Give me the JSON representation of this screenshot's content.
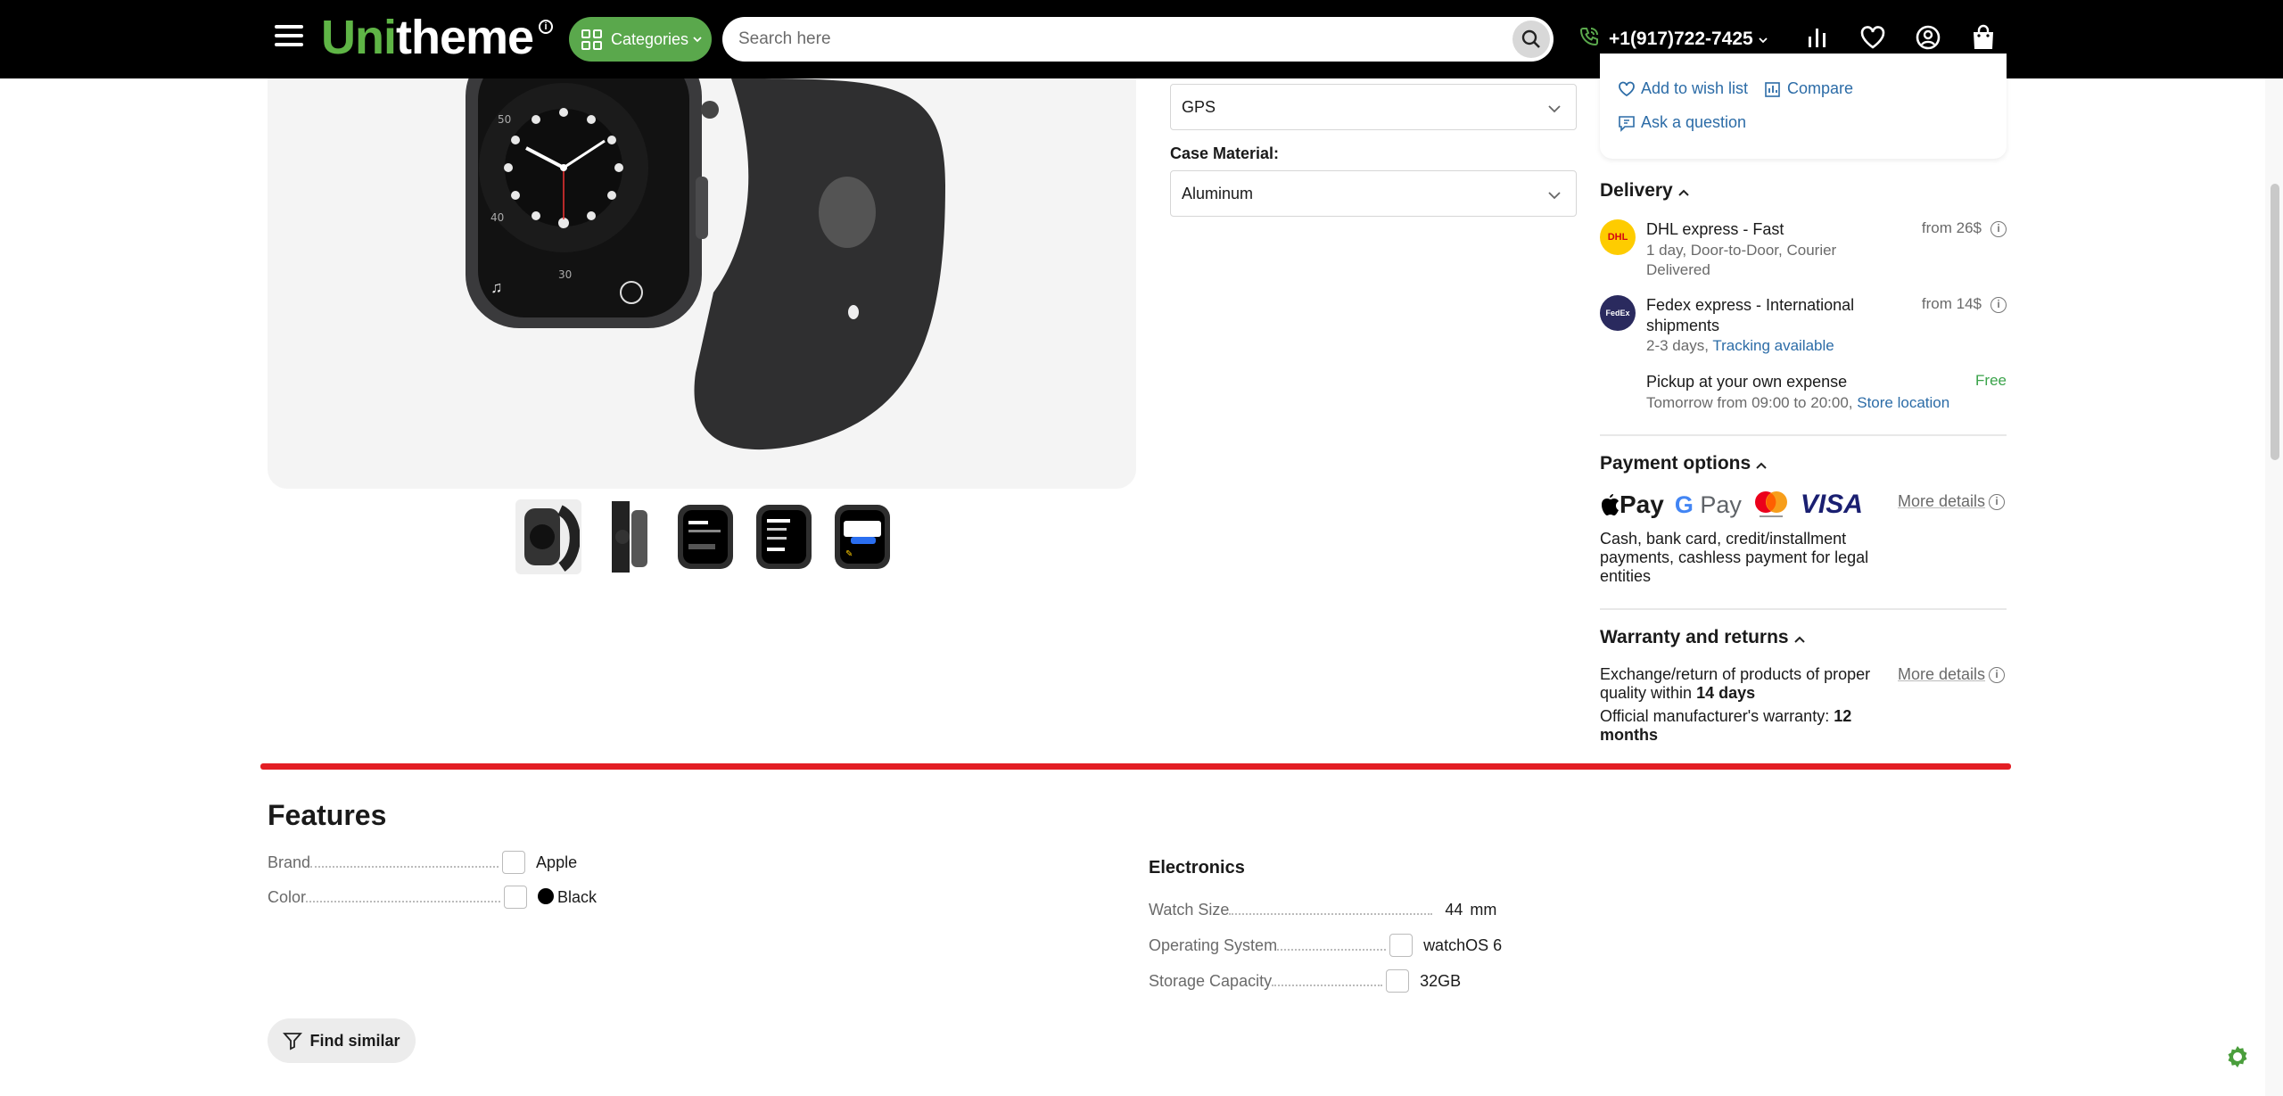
{
  "header": {
    "logo_part1": "Uni",
    "logo_part2": "theme",
    "categories_label": "Categories",
    "search_placeholder": "Search here",
    "phone": "+1(917)722-7425",
    "icons": [
      "menu-icon",
      "compare-chart-icon",
      "heart-icon",
      "user-icon",
      "bag-icon"
    ],
    "colors": {
      "background": "#000000",
      "accent": "#5aa84c"
    }
  },
  "gallery": {
    "thumbnail_count": 5,
    "active_thumbnail": 1
  },
  "options": {
    "connectivity_value": "GPS",
    "case_material_label": "Case Material:",
    "case_material_value": "Aluminum"
  },
  "actions": {
    "wish_list": "Add to wish list",
    "compare": "Compare",
    "ask_question": "Ask a question"
  },
  "delivery": {
    "title": "Delivery",
    "methods": [
      {
        "name": "DHL express - Fast",
        "sub": "1 day, Door-to-Door, Courier Delivered",
        "price": "from 26$",
        "logo": "DHL"
      },
      {
        "name": "Fedex express - International shipments",
        "sub": "2-3 days,",
        "sub_link": "Tracking available",
        "price": "from 14$",
        "logo": "FedEx"
      },
      {
        "name": "Pickup at your own expense",
        "sub": "Tomorrow from 09:00 to 20:00,",
        "sub_link": "Store location",
        "price": "Free"
      }
    ]
  },
  "payment": {
    "title": "Payment options",
    "logos": [
      "Apple Pay",
      "G Pay",
      "Mastercard",
      "VISA"
    ],
    "logo_text": {
      "apple": "Pay",
      "google": "Pay",
      "visa": "VISA"
    },
    "more": "More details",
    "text": "Cash, bank card, credit/installment payments, cashless payment for legal entities"
  },
  "warranty": {
    "title": "Warranty and returns",
    "more": "More details",
    "line1_prefix": "Exchange/return of products of proper quality within",
    "line1_bold": "14 days",
    "line2_prefix": "Official manufacturer's warranty:",
    "line2_bold": "12 months"
  },
  "features": {
    "title": "Features",
    "left": [
      {
        "name": "Brand",
        "value": "Apple"
      },
      {
        "name": "Color",
        "value": "Black"
      }
    ],
    "group_title": "Electronics",
    "right": [
      {
        "name": "Watch Size",
        "value": "44",
        "unit": "mm"
      },
      {
        "name": "Operating System",
        "value": "watchOS 6"
      },
      {
        "name": "Storage Capacity",
        "value": "32GB"
      }
    ],
    "find_similar": "Find similar"
  }
}
